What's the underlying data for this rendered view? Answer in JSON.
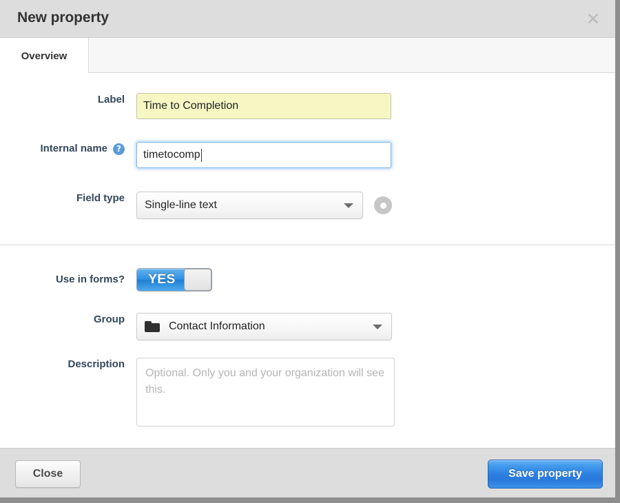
{
  "dialog": {
    "title": "New property",
    "close_icon": "close-icon",
    "close_glyph": "✕"
  },
  "tabs": [
    {
      "label": "Overview",
      "active": true
    }
  ],
  "form": {
    "label_field": {
      "label": "Label",
      "value": "Time to Completion",
      "state": "autofilled"
    },
    "internal_name_field": {
      "label": "Internal name",
      "value": "timetocomp",
      "help_icon": "help-circle-icon",
      "help_glyph": "?",
      "state": "focused"
    },
    "field_type": {
      "label": "Field type",
      "value": "Single-line text",
      "caret_icon": "chevron-down-icon",
      "preview_icon": "camera-preview-icon"
    },
    "use_in_forms": {
      "label": "Use in forms?",
      "value": "YES",
      "state": "on"
    },
    "group": {
      "label": "Group",
      "value": "Contact Information",
      "folder_icon": "folder-icon",
      "caret_icon": "chevron-down-icon"
    },
    "description": {
      "label": "Description",
      "value": "",
      "placeholder": "Optional. Only you and your organization will see this."
    }
  },
  "footer": {
    "close_label": "Close",
    "save_label": "Save property"
  },
  "colors": {
    "accent_blue": "#2b7fe0",
    "help_blue": "#5b9bd8",
    "autofill_yellow": "#f7f7c4",
    "titlebar_gray": "#dddddd",
    "footer_gray": "#dddddd",
    "placeholder_gray": "#b5b5b5"
  }
}
